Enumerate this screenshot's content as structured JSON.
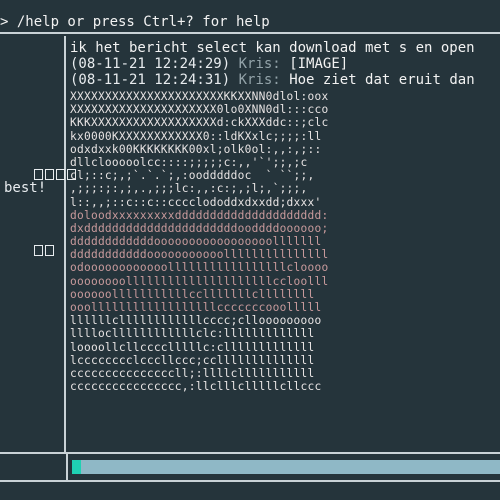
{
  "header": {
    "hint": "> /help or press Ctrl+? for help"
  },
  "sidebar": {
    "boxes_text": "□□□□",
    "status_text": "best!",
    "small_boxes": "□□"
  },
  "chat": {
    "messages": [
      {
        "text": "ik het bericht select kan download met s en open"
      },
      {
        "timestamp": "(08-11-21 12:24:29)",
        "author": "Kris:",
        "text": "[IMAGE]"
      },
      {
        "timestamp": "(08-11-21 12:24:31)",
        "author": "Kris:",
        "text": "Hoe ziet dat eruit dan"
      }
    ],
    "ascii_lines": [
      "XXXXXXXXXXXXXXXXXXXXXXKKXXNN0dlol:oox",
      "XXXXXXXXXXXXXXXXXXXXX0lo0XNN0dl:::cco",
      "KKKXXXXXXXXXXXXXXXXXXd:ckXXXddc::;clc",
      "kx0000KXXXXXXXXXXXX0::ldKXxlc;;;;:ll",
      "odxdxxk00KKKKKKKK00xl;olk0ol:,,:,;::",
      "dllclooooolcc::::;;;;;c:,,'`';;,;c",
      "cl;::c;,;`.`.`;,:oodddddoc  ` ``;;,",
      ",;;;:;:,;,.,;;;lc:,,:c:;,;l;,`;;;,",
      "l::,,;::c::c::cccclododdxdxxdd;dxxx'",
      "doloodxxxxxxxxxddddddddddddddddddddd:",
      "dxddddddddddddddddddddddooddddoooooo;",
      "ddddddddddddooooooooooooooooolllllll",
      "dddddddddddooooooooooolllllllllllllll",
      "odoooooooooooolllllllllllllllllcloooo",
      "oooooooolllllllllllllllllllllccloolll",
      "oooooolllllllllllcclllllllcllllllll",
      "ooollllllllllllllllllcccccccooolllll",
      "llllllcllllllllllllcccc;cllooooooooo",
      "llllocllllllllllllclc:lllllllllllll",
      "loooollcllcccclllllc:clllllllllllll",
      "lcccccccclcccllccc;ccllllllllllllll",
      "cccccccccccccccll;:llllclllllllllll",
      "cccccccccccccccc,:llclllclllllcllccc"
    ]
  },
  "input": {
    "progress_fraction": 0.02
  },
  "colors": {
    "background": "#25343b",
    "border": "#c9d2d6",
    "progress_track": "#8fb8c6",
    "progress_fill": "#1fd1b3",
    "ascii_light": "#e8e4e4",
    "ascii_warm": "#c89a9c",
    "ascii_dim": "#7f8a8e"
  }
}
